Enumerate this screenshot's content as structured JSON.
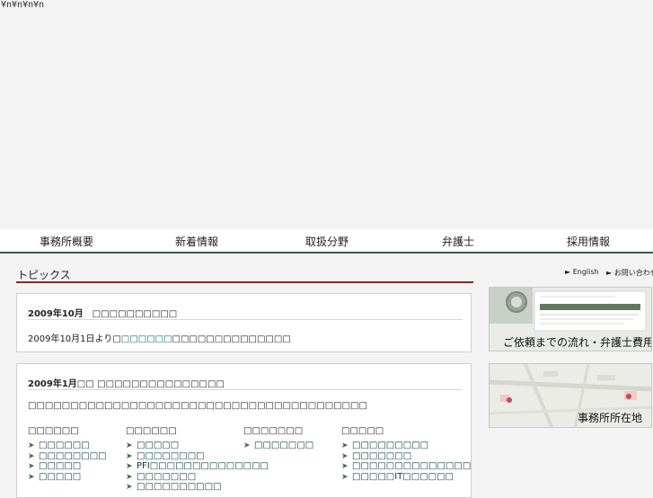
{
  "stray_text": "¥n¥n¥n¥n",
  "nav": {
    "items": [
      "事務所概要",
      "新着情報",
      "取扱分野",
      "弁護士",
      "採用情報"
    ]
  },
  "topics": {
    "title": "トピックス"
  },
  "card1": {
    "title": "2009年10月　□□□□□□□□□□",
    "text_before": "2009年10月1日より□",
    "link": "□□□□□□",
    "text_after": "□□□□□□□□□□□□□□"
  },
  "card2": {
    "title": "2009年1月□□ □□□□□□□□□□□□□□□",
    "intro": "□□□□□□□□□□□□□□□□□□□□□□□□□□□□□□□□□□□□□□□□",
    "columns": [
      {
        "head": "□□□□□□",
        "items": [
          "□□□□□□",
          "□□□□□□□□",
          "□□□□□",
          "□□□□□"
        ]
      },
      {
        "head": "□□□□□□",
        "items": [
          "□□□□□",
          "□□□□□□□□",
          "PFI□□□□□□□□□□□□□□",
          "□□□□□□□",
          "□□□□□□□□□□"
        ]
      },
      {
        "head": "□□□□□□□",
        "items": [
          "□□□□□□□"
        ]
      },
      {
        "head": "□□□□□",
        "items": [
          "□□□□□□□□□",
          "□□□□□□□",
          "□□□□□□□□□□□□□□",
          "□□□□□IT□□□□□□"
        ]
      }
    ]
  },
  "utility": {
    "english": "► English",
    "contact": "► お問い合わせ"
  },
  "banners": {
    "fees": "ご依頼までの流れ・弁護士費用",
    "location": "事務所所在地"
  },
  "colors": {
    "accent_red": "#8b2a23",
    "nav_rule": "#3d5a45",
    "link": "#0a6b6b"
  }
}
